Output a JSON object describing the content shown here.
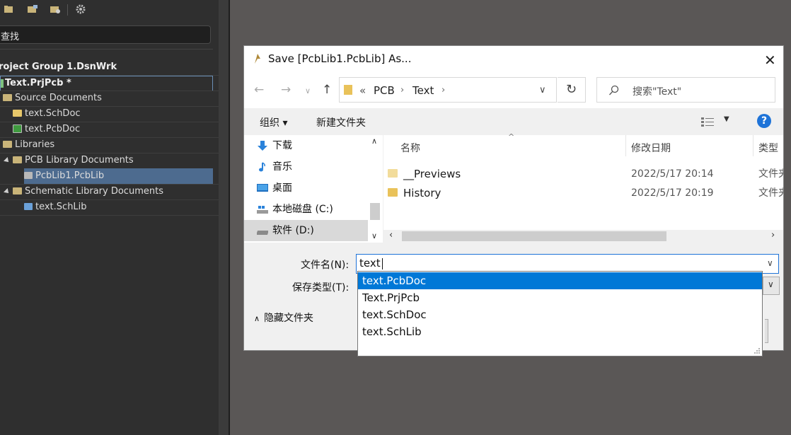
{
  "left_panel": {
    "search_label": "查找",
    "tree": [
      {
        "label": "roject Group 1.DsnWrk"
      },
      {
        "label": "Text.PrjPcb *"
      },
      {
        "label": "Source Documents"
      },
      {
        "label": "text.SchDoc"
      },
      {
        "label": "text.PcbDoc"
      },
      {
        "label": "Libraries"
      },
      {
        "label": "PCB Library Documents"
      },
      {
        "label": "PcbLib1.PcbLib"
      },
      {
        "label": "Schematic Library Documents"
      },
      {
        "label": "text.SchLib"
      }
    ]
  },
  "dialog": {
    "title": "Save [PcbLib1.PcbLib] As...",
    "breadcrumb": {
      "overflow": "«",
      "items": [
        "PCB",
        "Text"
      ]
    },
    "search_placeholder": "搜索\"Text\"",
    "organize_label": "组织 ▾",
    "new_folder_label": "新建文件夹",
    "help_label": "?",
    "nav_items": [
      {
        "label": "下载",
        "icon": "download-icon"
      },
      {
        "label": "音乐",
        "icon": "music-icon"
      },
      {
        "label": "桌面",
        "icon": "desktop-icon"
      },
      {
        "label": "本地磁盘 (C:)",
        "icon": "drive-icon"
      },
      {
        "label": "软件 (D:)",
        "icon": "drive-icon"
      }
    ],
    "columns": {
      "name": "名称",
      "date": "修改日期",
      "type": "类型"
    },
    "files": [
      {
        "name": "__Previews",
        "date": "2022/5/17 20:14",
        "type": "文件夹"
      },
      {
        "name": "History",
        "date": "2022/5/17 20:19",
        "type": "文件夹"
      }
    ],
    "filename_label": "文件名(N):",
    "filename_value": "text",
    "filetype_label": "保存类型(T):",
    "hide_folders_label": "隐藏文件夹",
    "autocomplete": [
      "text.PcbDoc",
      "Text.PrjPcb",
      "text.SchDoc",
      "text.SchLib"
    ]
  },
  "colors": {
    "accent": "#0078d7",
    "panel_bg": "#2f2f2f",
    "workspace": "#5a5756"
  }
}
